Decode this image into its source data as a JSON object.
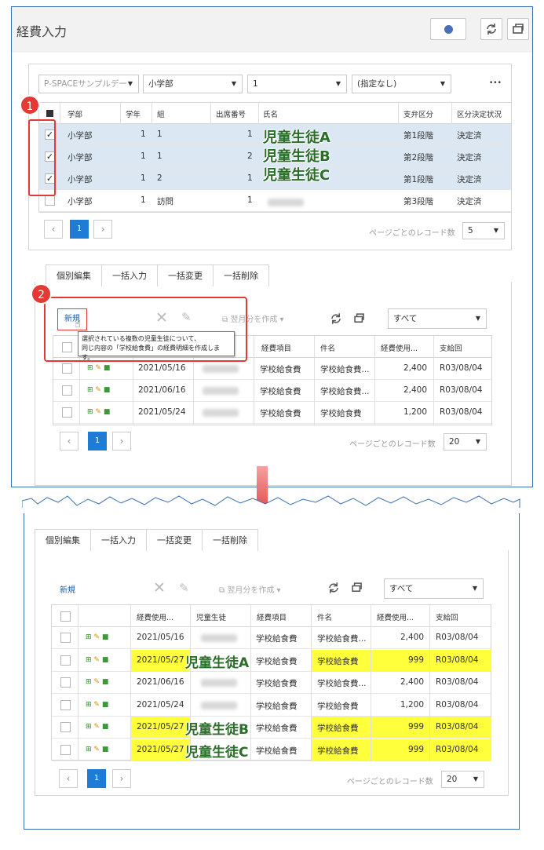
{
  "top": {
    "title": "経費入力",
    "filters": [
      "P-SPACEサンプルデー",
      "小学部",
      "1",
      "(指定なし)"
    ],
    "more": "•••",
    "columns": [
      "学部",
      "学年",
      "組",
      "出席番号",
      "氏名",
      "支弁区分",
      "区分決定状況"
    ],
    "rows": [
      {
        "dept": "小学部",
        "grade": "1",
        "cls": "1",
        "num": "1",
        "div": "第1段階",
        "status": "決定済",
        "checked": true
      },
      {
        "dept": "小学部",
        "grade": "1",
        "cls": "1",
        "num": "2",
        "div": "第2段階",
        "status": "決定済",
        "checked": true
      },
      {
        "dept": "小学部",
        "grade": "1",
        "cls": "2",
        "num": "1",
        "div": "第1段階",
        "status": "決定済",
        "checked": true
      },
      {
        "dept": "小学部",
        "grade": "1",
        "cls": "訪問",
        "num": "1",
        "div": "第3段階",
        "status": "決定済",
        "checked": false
      }
    ],
    "names": [
      "児童生徒A",
      "児童生徒B",
      "児童生徒C"
    ],
    "page": "1",
    "page_size_label": "ページごとのレコード数",
    "page_size": "5",
    "tabs": [
      "個別編集",
      "一括入力",
      "一括変更",
      "一括削除"
    ],
    "new_label": "新規",
    "next_month": "翌月分を作成",
    "filter_all": "すべて",
    "tooltip_line1": "選択されている複数の児童生徒について、",
    "tooltip_line2": "同じ内容の「学校給食費」の経費明細を作成します。",
    "sub_columns": [
      "経費項目",
      "件名",
      "経費使用...",
      "支給回"
    ],
    "sub_rows": [
      {
        "date": "2021/05/16",
        "item": "学校給食費",
        "subject": "学校給食費...",
        "amount": "2,400",
        "round": "R03/08/04"
      },
      {
        "date": "2021/06/16",
        "item": "学校給食費",
        "subject": "学校給食費...",
        "amount": "2,400",
        "round": "R03/08/04"
      },
      {
        "date": "2021/05/24",
        "item": "学校給食費",
        "subject": "学校給食費",
        "amount": "1,200",
        "round": "R03/08/04"
      }
    ],
    "sub_page_size": "20",
    "badge1": "1",
    "badge2": "2"
  },
  "bottom": {
    "tabs": [
      "個別編集",
      "一括入力",
      "一括変更",
      "一括削除"
    ],
    "new_label": "新規",
    "next_month": "翌月分を作成",
    "filter_all": "すべて",
    "columns": [
      "経費使用...",
      "児童生徒",
      "経費項目",
      "件名",
      "経費使用...",
      "支給回"
    ],
    "rows": [
      {
        "date": "2021/05/16",
        "name": "",
        "item": "学校給食費",
        "subject": "学校給食費...",
        "amount": "2,400",
        "round": "R03/08/04",
        "hl": false
      },
      {
        "date": "2021/05/27",
        "name": "児童生徒A",
        "item": "学校給食費",
        "subject": "学校給食費",
        "amount": "999",
        "round": "R03/08/04",
        "hl": true
      },
      {
        "date": "2021/06/16",
        "name": "",
        "item": "学校給食費",
        "subject": "学校給食費...",
        "amount": "2,400",
        "round": "R03/08/04",
        "hl": false
      },
      {
        "date": "2021/05/24",
        "name": "",
        "item": "学校給食費",
        "subject": "学校給食費",
        "amount": "1,200",
        "round": "R03/08/04",
        "hl": false
      },
      {
        "date": "2021/05/27",
        "name": "児童生徒B",
        "item": "学校給食費",
        "subject": "学校給食費",
        "amount": "999",
        "round": "R03/08/04",
        "hl": true
      },
      {
        "date": "2021/05/27",
        "name": "児童生徒C",
        "item": "学校給食費",
        "subject": "学校給食費",
        "amount": "999",
        "round": "R03/08/04",
        "hl": true
      }
    ],
    "page": "1",
    "page_size_label": "ページごとのレコード数",
    "page_size": "20"
  },
  "colors": {
    "accent": "#1f7cd6",
    "highlight": "#ffff3c",
    "callout": "#e53935",
    "frame": "#3a6fb5"
  }
}
